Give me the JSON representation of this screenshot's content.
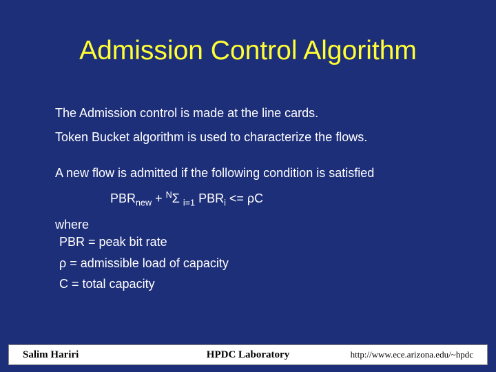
{
  "title": "Admission Control Algorithm",
  "lines": {
    "l1": "The Admission control is made at the line cards.",
    "l2": "Token Bucket algorithm is used to characterize the flows.",
    "l3": "A new flow is admitted if the following condition is satisfied"
  },
  "formula": {
    "pbr": "PBR",
    "new": "new",
    "plus": " + ",
    "N": "N",
    "sigma": "Σ ",
    "i1": "i=1",
    "sp": " ",
    "pbr2": "PBR",
    "i": "i",
    "le": " <= ρC"
  },
  "where": "where",
  "defs": {
    "d1": "PBR = peak bit rate",
    "d2": "ρ = admissible load of capacity",
    "d3": "C = total capacity"
  },
  "footer": {
    "left": "Salim  Hariri",
    "center": "HPDC Laboratory",
    "right": "http://www.ece.arizona.edu/~hpdc"
  }
}
